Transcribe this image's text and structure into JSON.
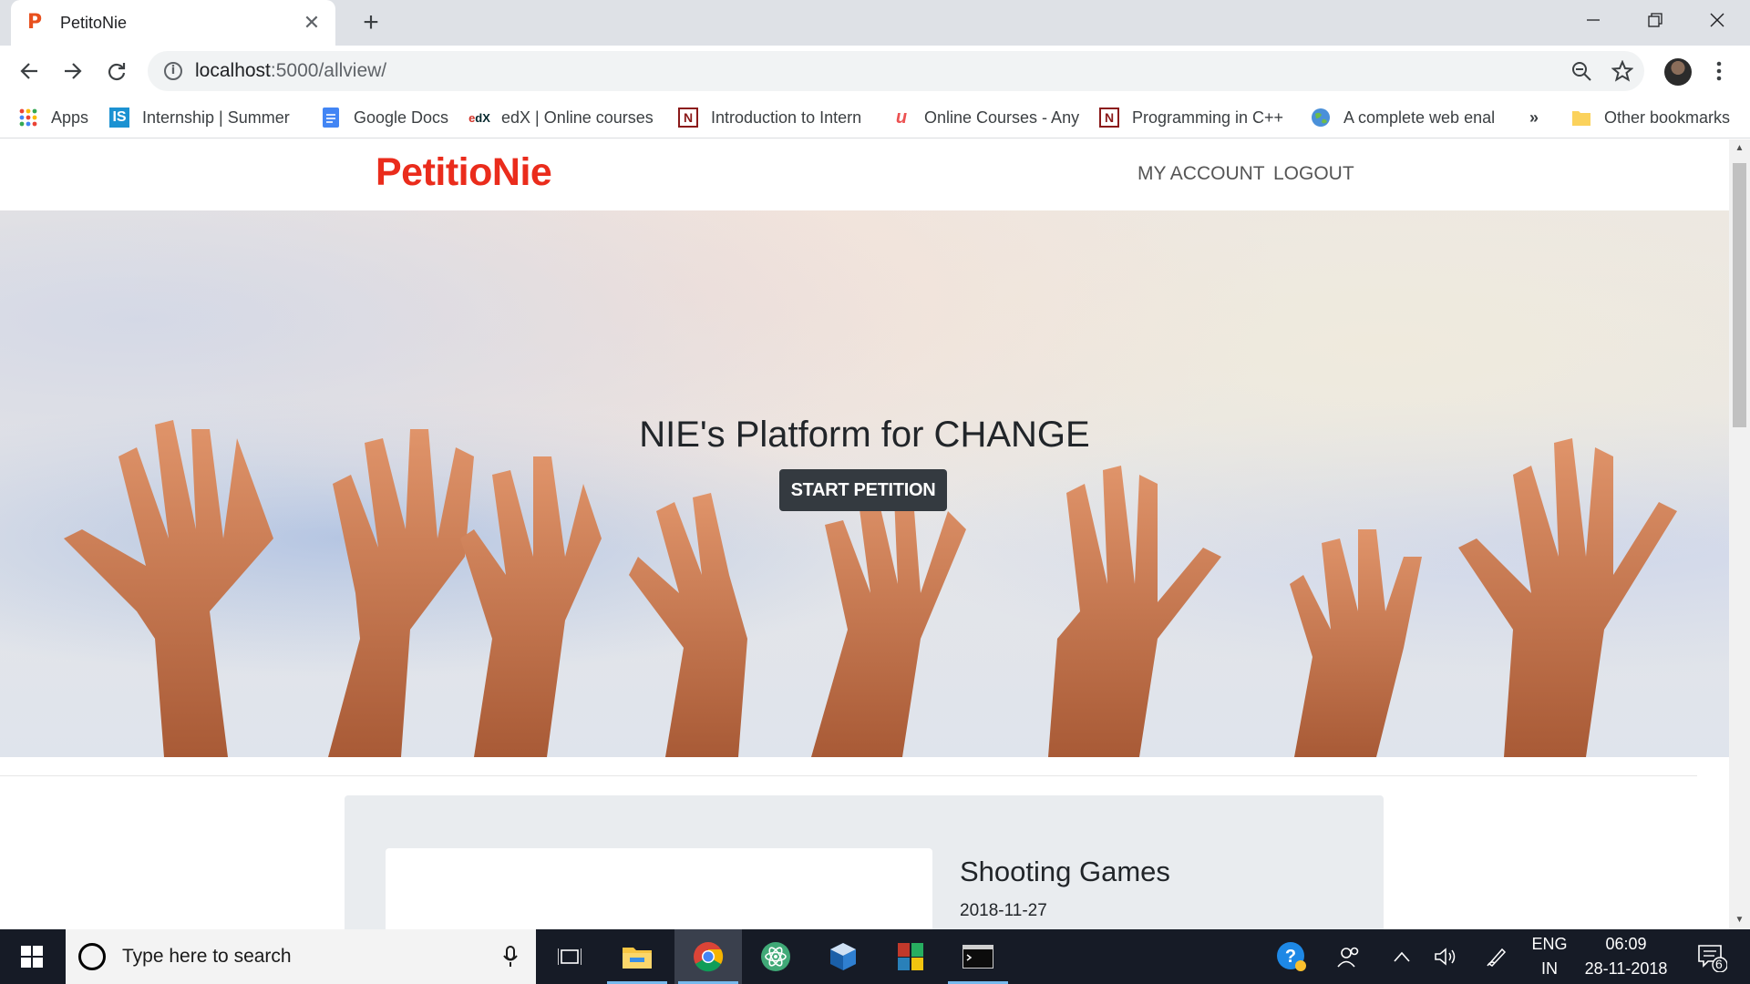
{
  "browser": {
    "tab_title": "PetitoNie",
    "tab_favicon_letter": "P",
    "url_host": "localhost",
    "url_rest": ":5000/allview/",
    "bookmarks": [
      {
        "label": "Apps",
        "icon": "apps-grid-icon"
      },
      {
        "label": "Internship | Summer",
        "icon": "internshala-icon"
      },
      {
        "label": "Google Docs",
        "icon": "google-docs-icon"
      },
      {
        "label": "edX | Online courses",
        "icon": "edx-icon"
      },
      {
        "label": "Introduction to Intern",
        "icon": "nptel-icon"
      },
      {
        "label": "Online Courses - Any",
        "icon": "udemy-icon"
      },
      {
        "label": "Programming in C++",
        "icon": "nptel-icon"
      },
      {
        "label": "A complete web enal",
        "icon": "globe-icon"
      }
    ],
    "more_bookmarks": "»",
    "other_bookmarks": "Other bookmarks"
  },
  "site": {
    "logo": "PetitioNie",
    "nav": [
      "MY ACCOUNT",
      "LOGOUT"
    ],
    "hero_title": "NIE's Platform for CHANGE",
    "hero_button": "START PETITION",
    "petition": {
      "title": "Shooting Games",
      "date": "2018-11-27"
    }
  },
  "taskbar": {
    "search_placeholder": "Type here to search",
    "lang_top": "ENG",
    "lang_bottom": "IN",
    "time": "06:09",
    "date": "28-11-2018",
    "notification_count": "6",
    "apps": [
      "task-view-icon",
      "file-explorer-icon",
      "chrome-icon",
      "atom-icon",
      "virtualbox-icon",
      "winrar-icon",
      "terminal-icon"
    ]
  },
  "colors": {
    "brand": "#ea2c1c",
    "button_dark": "#343a40",
    "taskbar": "#161b26"
  }
}
